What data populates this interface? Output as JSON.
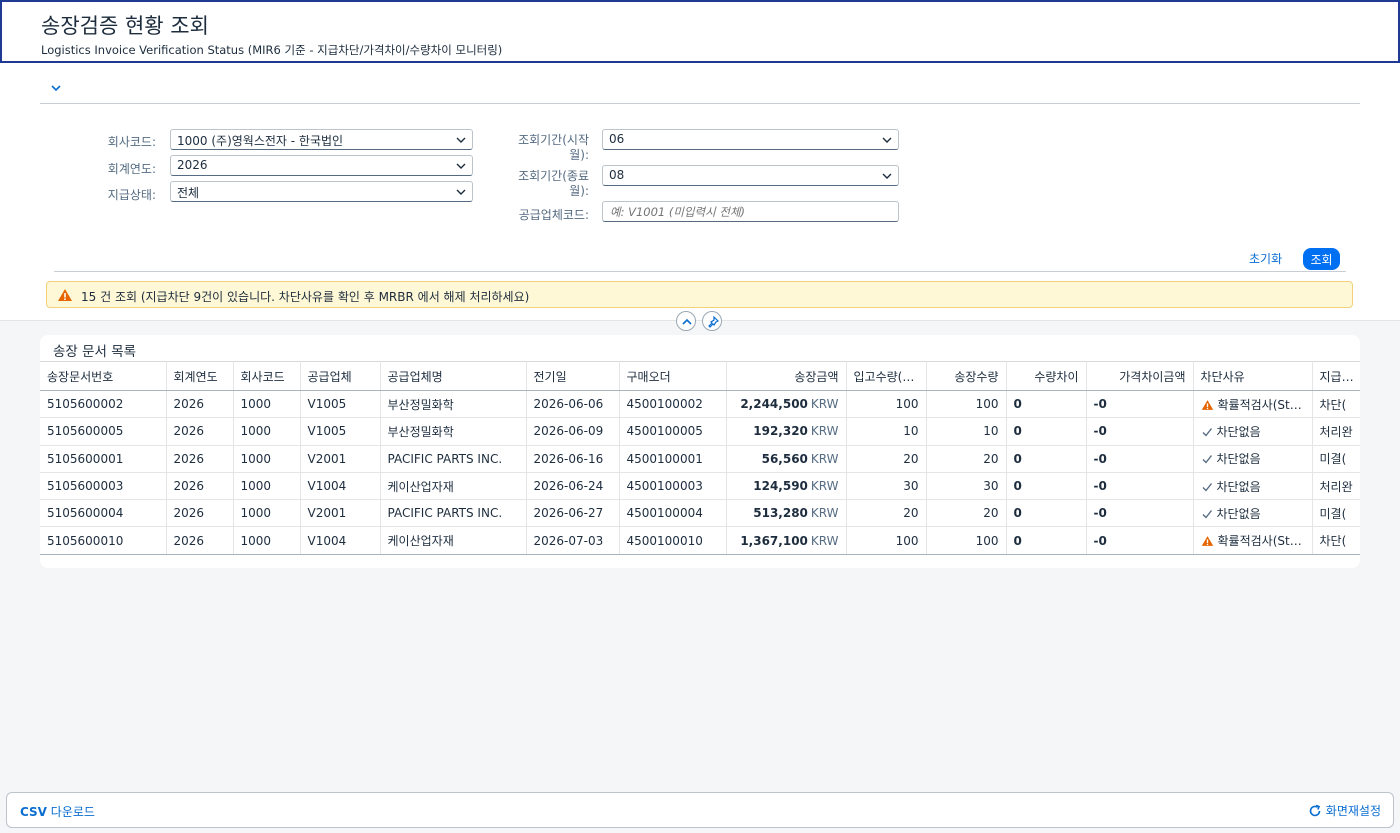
{
  "header": {
    "title": "송장검증 현황 조회",
    "subtitle": "Logistics Invoice Verification Status (MIR6 기준 - 지급차단/가격차이/수량차이 모니터링)"
  },
  "filters": {
    "company_label": "회사코드:",
    "company_value": "1000 (주)영웍스전자 - 한국법인",
    "year_label": "회계연도:",
    "year_value": "2026",
    "pay_status_label": "지급상태:",
    "pay_status_value": "전체",
    "period_from_label_1": "조회기간(시작",
    "period_from_label_2": "월):",
    "period_from_value": "06",
    "period_to_label_1": "조회기간(종료",
    "period_to_label_2": "월):",
    "period_to_value": "08",
    "vendor_label": "공급업체코드:",
    "vendor_placeholder": "예: V1001 (미입력시 전체)"
  },
  "actions": {
    "reset_label": "초기화",
    "search_label": "조회"
  },
  "message": {
    "text": "15 건 조회 (지급차단 9건이 있습니다. 차단사유를 확인 후 MRBR 에서 해제 처리하세요)"
  },
  "table": {
    "title": "송장 문서 목록",
    "columns": [
      "송장문서번호",
      "회계연도",
      "회사코드",
      "공급업체",
      "공급업체명",
      "전기일",
      "구매오더",
      "송장금액",
      "입고수량(…",
      "송장수량",
      "수량차이",
      "가격차이금액",
      "차단사유",
      "지급…"
    ],
    "currency": "KRW",
    "rows": [
      {
        "doc": "5105600002",
        "year": "2026",
        "company": "1000",
        "vendor": "V1005",
        "vendor_name": "부산정밀화학",
        "post_date": "2026-06-06",
        "po": "4500100002",
        "amount": "2,244,500",
        "gr_qty": "100",
        "inv_qty": "100",
        "qty_diff": "0",
        "price_diff": "-0",
        "block": "확률적검사(St…",
        "block_type": "warn",
        "pay": "차단(",
        "pay_type": "block"
      },
      {
        "doc": "5105600005",
        "year": "2026",
        "company": "1000",
        "vendor": "V1005",
        "vendor_name": "부산정밀화학",
        "post_date": "2026-06-09",
        "po": "4500100005",
        "amount": "192,320",
        "gr_qty": "10",
        "inv_qty": "10",
        "qty_diff": "0",
        "price_diff": "-0",
        "block": "차단없음",
        "block_type": "ok",
        "pay": "처리완",
        "pay_type": "done"
      },
      {
        "doc": "5105600001",
        "year": "2026",
        "company": "1000",
        "vendor": "V2001",
        "vendor_name": "PACIFIC PARTS INC.",
        "post_date": "2026-06-16",
        "po": "4500100001",
        "amount": "56,560",
        "gr_qty": "20",
        "inv_qty": "20",
        "qty_diff": "0",
        "price_diff": "-0",
        "block": "차단없음",
        "block_type": "ok",
        "pay": "미결(",
        "pay_type": "pend"
      },
      {
        "doc": "5105600003",
        "year": "2026",
        "company": "1000",
        "vendor": "V1004",
        "vendor_name": "케이산업자재",
        "post_date": "2026-06-24",
        "po": "4500100003",
        "amount": "124,590",
        "gr_qty": "30",
        "inv_qty": "30",
        "qty_diff": "0",
        "price_diff": "-0",
        "block": "차단없음",
        "block_type": "ok",
        "pay": "처리완",
        "pay_type": "done"
      },
      {
        "doc": "5105600004",
        "year": "2026",
        "company": "1000",
        "vendor": "V2001",
        "vendor_name": "PACIFIC PARTS INC.",
        "post_date": "2026-06-27",
        "po": "4500100004",
        "amount": "513,280",
        "gr_qty": "20",
        "inv_qty": "20",
        "qty_diff": "0",
        "price_diff": "-0",
        "block": "차단없음",
        "block_type": "ok",
        "pay": "미결(",
        "pay_type": "pend"
      },
      {
        "doc": "5105600010",
        "year": "2026",
        "company": "1000",
        "vendor": "V1004",
        "vendor_name": "케이산업자재",
        "post_date": "2026-07-03",
        "po": "4500100010",
        "amount": "1,367,100",
        "gr_qty": "100",
        "inv_qty": "100",
        "qty_diff": "0",
        "price_diff": "-0",
        "block": "확률적검사(St…",
        "block_type": "warn",
        "pay": "차단(",
        "pay_type": "block"
      }
    ]
  },
  "footer": {
    "csv_bold": "CSV",
    "csv_rest": " 다운로드",
    "reset_view": "화면재설정"
  },
  "icons": {
    "collapse": "chevron-down-icon",
    "dropdown": "chevron-down-icon",
    "warning": "warning-triangle-icon",
    "collapse_header": "chevron-up-icon",
    "pin": "pin-icon",
    "check": "check-icon",
    "refresh": "refresh-icon"
  },
  "colors": {
    "accent": "#0070f2",
    "link": "#0a6ed1",
    "warning": "#e76500",
    "error": "#bb0000",
    "success": "#256f3a",
    "message_bg": "#fff8d6"
  }
}
